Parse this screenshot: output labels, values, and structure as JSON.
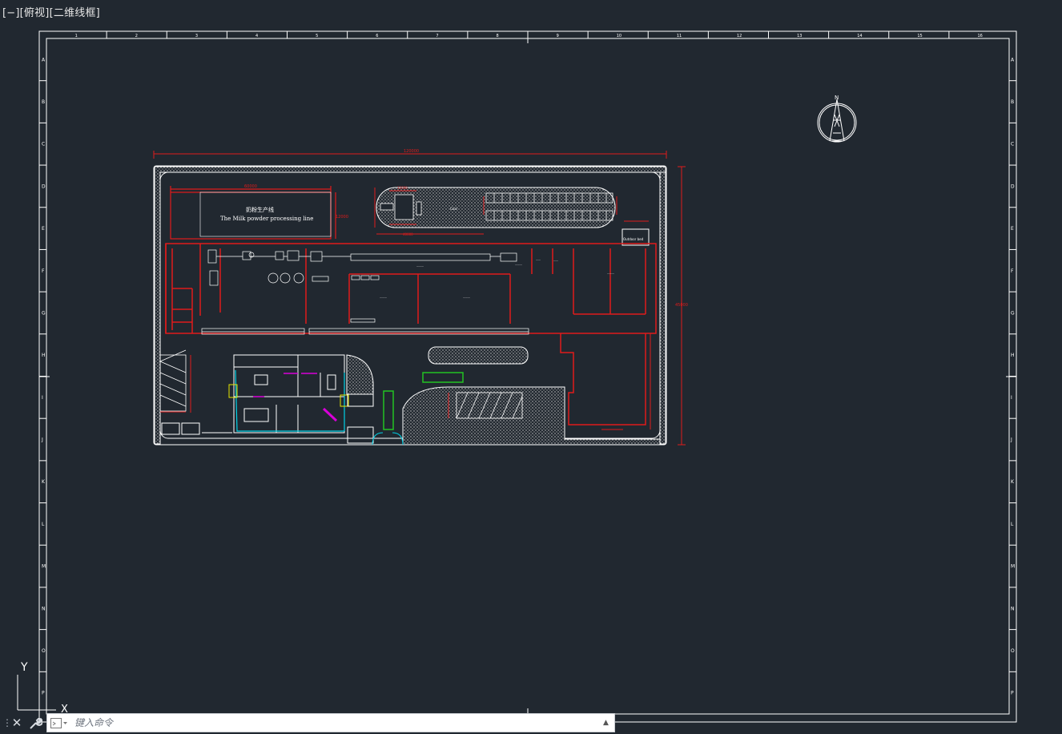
{
  "viewport": {
    "controls": "[−]",
    "view": "[俯视]",
    "style": "[二维线框]"
  },
  "ucs": {
    "y_label": "Y",
    "x_label": "X"
  },
  "frame": {
    "column_numbers": [
      "1",
      "2",
      "3",
      "4",
      "5",
      "6",
      "7",
      "8",
      "9",
      "10",
      "11",
      "12",
      "13",
      "14",
      "15",
      "16"
    ],
    "row_letters": [
      "A",
      "B",
      "C",
      "D",
      "E",
      "F",
      "G",
      "H",
      "I",
      "J",
      "K",
      "L",
      "M",
      "N",
      "O",
      "P"
    ]
  },
  "north_arrow": {
    "label": "N"
  },
  "plan": {
    "overall_width_dim": "120000",
    "overall_height_dim": "45000",
    "line_box_cn": "奶粉生产线",
    "line_box_en": "The Milk powder processing line",
    "line_box_dim": "60000",
    "line_box_height_dim": "12000",
    "top_dim_a": "12000",
    "top_dim_b": "40000",
    "guard_room_en": "Outdoor bed",
    "coal_label": "Coal"
  },
  "command_line": {
    "placeholder": "键入命令"
  },
  "colors": {
    "background": "#212830",
    "frame": "#ffffff",
    "walls": "#e01b1b",
    "linework": "#ffffff",
    "cyan": "#00d2e6",
    "magenta": "#d800d8",
    "green": "#22c322",
    "yellow": "#e6e600"
  }
}
